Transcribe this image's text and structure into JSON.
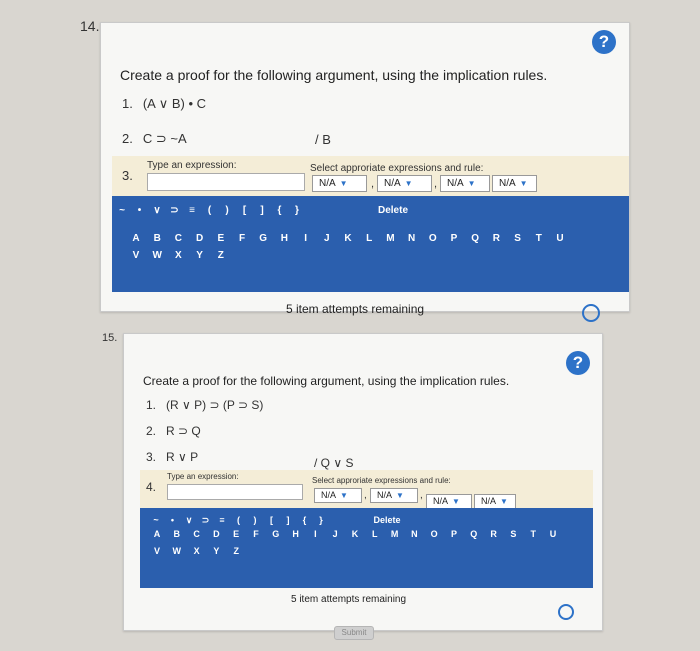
{
  "questions": [
    {
      "number": "14.",
      "prompt": "Create a proof for the following argument, using the implication rules.",
      "lines": [
        {
          "n": "1.",
          "text": "(A ∨ B) • C"
        },
        {
          "n": "2.",
          "text": "C ⊃ ~A"
        }
      ],
      "conclusion": "/ B",
      "entry": {
        "line_number": "3.",
        "expression_label": "Type an expression:",
        "rule_label": "Select approriate expressions and rule:",
        "selects": [
          "N/A",
          "N/A",
          "N/A",
          "N/A"
        ]
      },
      "symbols_row1": [
        "~",
        "•",
        "∨",
        "⊃",
        "≡",
        "(",
        ")",
        "[",
        "]",
        "{",
        "}",
        "Delete"
      ],
      "letters_row1": [
        "A",
        "B",
        "C",
        "D",
        "E",
        "F",
        "G",
        "H",
        "I",
        "J",
        "K",
        "L",
        "M",
        "N",
        "O",
        "P",
        "Q",
        "R",
        "S",
        "T",
        "U"
      ],
      "letters_row2": [
        "V",
        "W",
        "X",
        "Y",
        "Z"
      ],
      "attempts": "5 item attempts remaining"
    },
    {
      "number": "15.",
      "prompt": "Create a proof for the following argument, using the implication rules.",
      "lines": [
        {
          "n": "1.",
          "text": "(R ∨ P) ⊃ (P ⊃ S)"
        },
        {
          "n": "2.",
          "text": "R ⊃ Q"
        },
        {
          "n": "3.",
          "text": "R ∨ P"
        }
      ],
      "conclusion": "/ Q ∨ S",
      "entry": {
        "line_number": "4.",
        "expression_label": "Type an expression:",
        "rule_label": "Select approriate expressions and rule:",
        "selects": [
          "N/A",
          "N/A",
          "N/A",
          "N/A"
        ]
      },
      "symbols_row1": [
        "~",
        "•",
        "∨",
        "⊃",
        "≡",
        "(",
        ")",
        "[",
        "]",
        "{",
        "}",
        "Delete"
      ],
      "letters_row1": [
        "A",
        "B",
        "C",
        "D",
        "E",
        "F",
        "G",
        "H",
        "I",
        "J",
        "K",
        "L",
        "M",
        "N",
        "O",
        "P",
        "Q",
        "R",
        "S",
        "T",
        "U"
      ],
      "letters_row2": [
        "V",
        "W",
        "X",
        "Y",
        "Z"
      ],
      "attempts": "5 item attempts remaining",
      "submit_label": "Submit"
    }
  ],
  "help_label": "?",
  "colors": {
    "panel": "#2b5fae",
    "accent": "#2d72c8",
    "band": "#f4edd7"
  }
}
